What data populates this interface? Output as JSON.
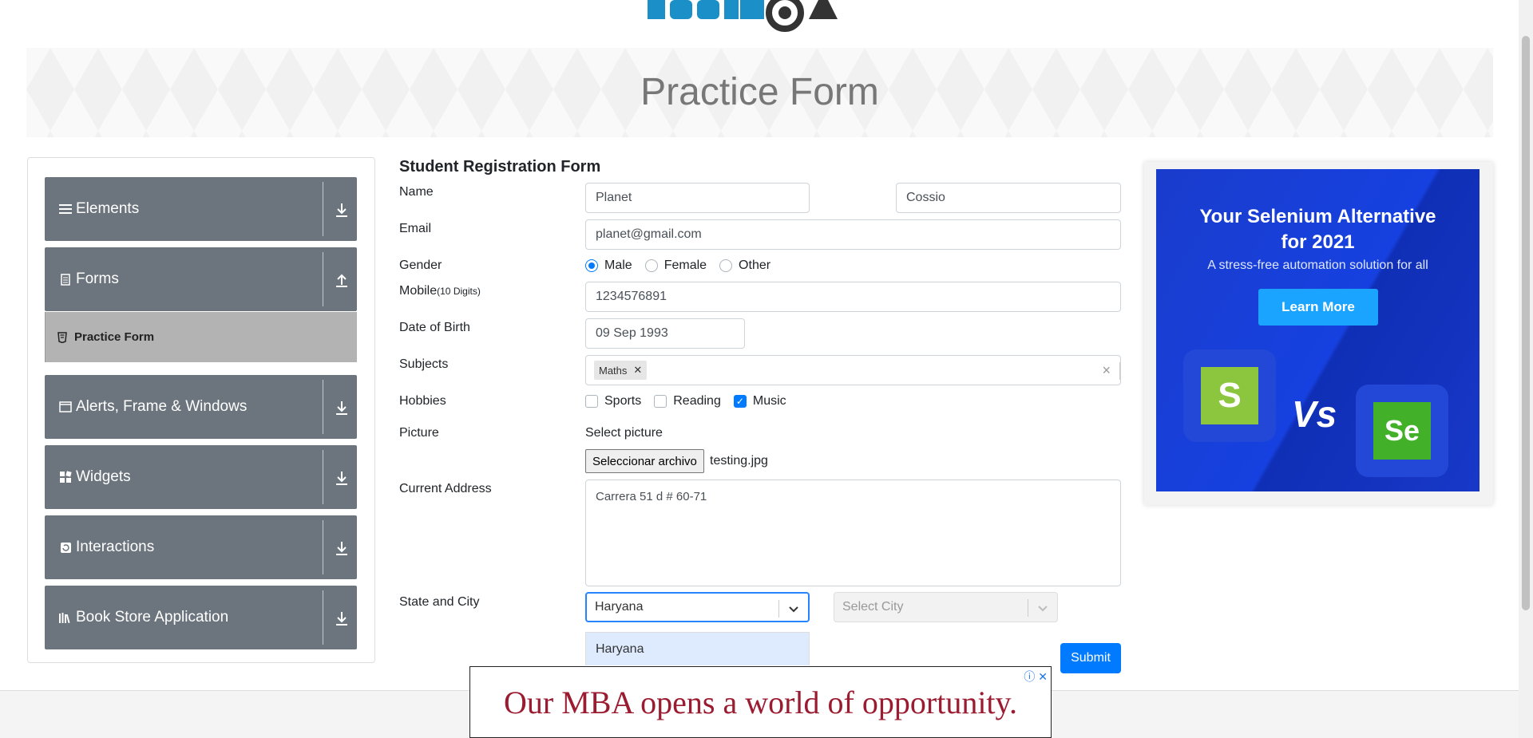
{
  "header": {
    "logo_alt": "TOOLSQA"
  },
  "banner": {
    "title": "Practice Form"
  },
  "sidebar": {
    "groups": [
      {
        "label": "Elements",
        "icon": "menu-icon",
        "expanded": false
      },
      {
        "label": "Forms",
        "icon": "document-icon",
        "expanded": true,
        "items": [
          {
            "label": "Practice Form",
            "active": true
          }
        ]
      },
      {
        "label": "Alerts, Frame & Windows",
        "icon": "window-icon",
        "expanded": false
      },
      {
        "label": "Widgets",
        "icon": "widgets-icon",
        "expanded": false
      },
      {
        "label": "Interactions",
        "icon": "interaction-icon",
        "expanded": false
      },
      {
        "label": "Book Store Application",
        "icon": "books-icon",
        "expanded": false
      }
    ]
  },
  "form": {
    "title": "Student Registration Form",
    "name_label": "Name",
    "first_name": "Planet",
    "last_name": "Cossio",
    "email_label": "Email",
    "email": "planet@gmail.com",
    "gender_label": "Gender",
    "genders": [
      "Male",
      "Female",
      "Other"
    ],
    "gender_selected": "Male",
    "mobile_label": "Mobile",
    "mobile_hint": "(10 Digits)",
    "mobile": "1234576891",
    "dob_label": "Date of Birth",
    "dob": "09 Sep 1993",
    "subjects_label": "Subjects",
    "subjects": [
      "Maths"
    ],
    "subjects_clear": "×",
    "hobbies_label": "Hobbies",
    "hobbies": [
      {
        "label": "Sports",
        "checked": false
      },
      {
        "label": "Reading",
        "checked": false
      },
      {
        "label": "Music",
        "checked": true
      }
    ],
    "picture_label": "Picture",
    "picture_prompt": "Select picture",
    "file_button": "Seleccionar archivo",
    "file_name": "testing.jpg",
    "address_label": "Current Address",
    "address": "Carrera 51 d # 60-71",
    "state_city_label": "State and City",
    "state_value": "Haryana",
    "city_placeholder": "Select City",
    "dropdown_option": "Haryana",
    "submit": "Submit"
  },
  "ad_right": {
    "title_line1": "Your Selenium Alternative",
    "title_line2": "for 2021",
    "subtitle": "A stress-free automation solution for all",
    "button": "Learn More",
    "vs": "Vs",
    "logo_left": "S",
    "logo_right": "Se"
  },
  "ad_bottom": {
    "text": "Our MBA opens a world of opportunity."
  },
  "colors": {
    "accent": "#007bff",
    "sidebar": "#6c757d",
    "sidebar_active": "#b3b3b3",
    "mba_red": "#9b1b30"
  }
}
